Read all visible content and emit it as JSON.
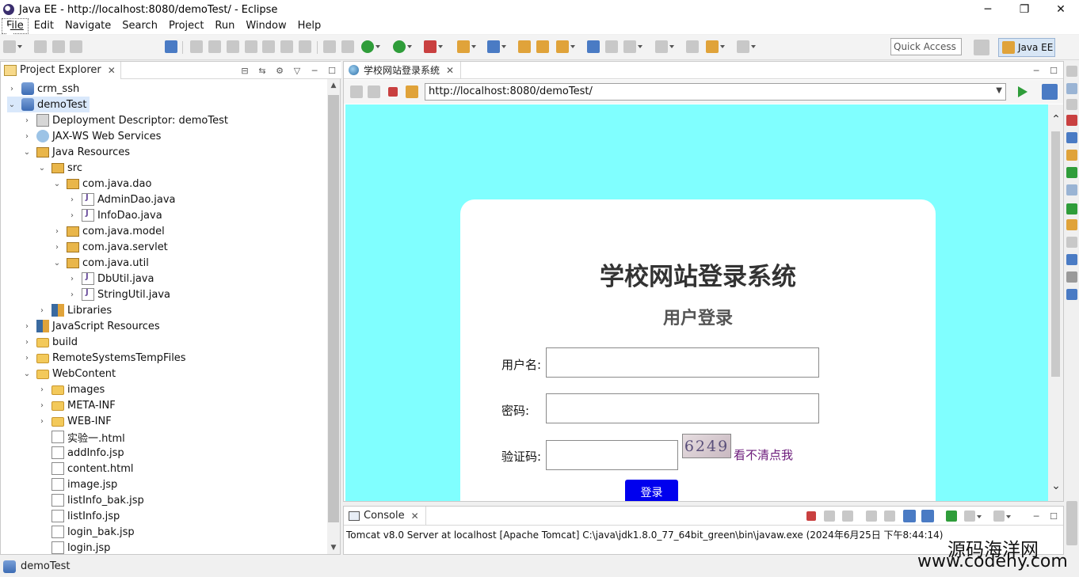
{
  "window": {
    "title": "Java EE - http://localhost:8080/demoTest/ - Eclipse",
    "minimize": "─",
    "restore": "❐",
    "close": "✕"
  },
  "menu": [
    "File",
    "Edit",
    "Navigate",
    "Search",
    "Project",
    "Run",
    "Window",
    "Help"
  ],
  "toolbar": {
    "quick_access_placeholder": "Quick Access",
    "perspective_label": "Java EE"
  },
  "explorer": {
    "title": "Project Explorer",
    "tree": [
      {
        "label": "crm_ssh",
        "icon": "project-icon",
        "kind": "project",
        "expanded": false
      },
      {
        "label": "demoTest",
        "icon": "project-icon",
        "kind": "project",
        "expanded": true,
        "selected": true
      },
      {
        "label": "Deployment Descriptor: demoTest",
        "icon": "deployment-descriptor-icon",
        "kind": "dd",
        "expanded": false
      },
      {
        "label": "JAX-WS Web Services",
        "icon": "web-services-icon",
        "kind": "ws",
        "expanded": false
      },
      {
        "label": "Java Resources",
        "icon": "java-resources-icon",
        "kind": "pkg",
        "expanded": true
      },
      {
        "label": "src",
        "icon": "source-folder-icon",
        "kind": "pkg",
        "expanded": true
      },
      {
        "label": "com.java.dao",
        "icon": "package-icon",
        "kind": "pkg",
        "expanded": true
      },
      {
        "label": "AdminDao.java",
        "icon": "java-file-icon",
        "kind": "java",
        "expanded": false
      },
      {
        "label": "InfoDao.java",
        "icon": "java-file-icon",
        "kind": "java",
        "expanded": false
      },
      {
        "label": "com.java.model",
        "icon": "package-icon",
        "kind": "pkg",
        "expanded": false
      },
      {
        "label": "com.java.servlet",
        "icon": "package-icon",
        "kind": "pkg",
        "expanded": false
      },
      {
        "label": "com.java.util",
        "icon": "package-icon",
        "kind": "pkg",
        "expanded": true
      },
      {
        "label": "DbUtil.java",
        "icon": "java-file-icon",
        "kind": "java",
        "expanded": false
      },
      {
        "label": "StringUtil.java",
        "icon": "java-file-icon",
        "kind": "java",
        "expanded": false
      },
      {
        "label": "Libraries",
        "icon": "libraries-icon",
        "kind": "lib",
        "expanded": false
      },
      {
        "label": "JavaScript Resources",
        "icon": "javascript-resources-icon",
        "kind": "lib",
        "expanded": false
      },
      {
        "label": "build",
        "icon": "folder-icon",
        "kind": "folder",
        "expanded": false
      },
      {
        "label": "RemoteSystemsTempFiles",
        "icon": "folder-icon",
        "kind": "folder",
        "expanded": false
      },
      {
        "label": "WebContent",
        "icon": "folder-icon",
        "kind": "folder",
        "expanded": true
      },
      {
        "label": "images",
        "icon": "folder-icon",
        "kind": "folder",
        "expanded": false
      },
      {
        "label": "META-INF",
        "icon": "folder-icon",
        "kind": "folder",
        "expanded": false
      },
      {
        "label": "WEB-INF",
        "icon": "folder-icon",
        "kind": "folder",
        "expanded": false
      },
      {
        "label": "实验一.html",
        "icon": "html-file-icon",
        "kind": "file",
        "expanded": false
      },
      {
        "label": "addInfo.jsp",
        "icon": "jsp-file-icon",
        "kind": "file",
        "expanded": false
      },
      {
        "label": "content.html",
        "icon": "html-file-icon",
        "kind": "file",
        "expanded": false
      },
      {
        "label": "image.jsp",
        "icon": "jsp-file-icon",
        "kind": "file",
        "expanded": false
      },
      {
        "label": "listInfo_bak.jsp",
        "icon": "jsp-file-icon",
        "kind": "file",
        "expanded": false
      },
      {
        "label": "listInfo.jsp",
        "icon": "jsp-file-icon",
        "kind": "file",
        "expanded": false
      },
      {
        "label": "login_bak.jsp",
        "icon": "jsp-file-icon",
        "kind": "file",
        "expanded": false
      },
      {
        "label": "login.jsp",
        "icon": "jsp-file-icon",
        "kind": "file",
        "expanded": false
      }
    ]
  },
  "status": {
    "selection": "demoTest"
  },
  "editor": {
    "tab_title": "学校网站登录系统",
    "url": "http://localhost:8080/demoTest/"
  },
  "login_page": {
    "title": "学校网站登录系统",
    "subtitle": "用户登录",
    "username_label": "用户名:",
    "password_label": "密码:",
    "captcha_label": "验证码:",
    "captcha_code": "6249",
    "captcha_refresh": "看不清点我",
    "submit": "登录",
    "background_color": "#80ffff"
  },
  "console": {
    "title": "Console",
    "line": "Tomcat v8.0 Server at localhost [Apache Tomcat] C:\\java\\jdk1.8.0_77_64bit_green\\bin\\javaw.exe (2024年6月25日 下午8:44:14)"
  },
  "watermark": {
    "cn": "源码海洋网",
    "url": "www.codehy.com"
  }
}
